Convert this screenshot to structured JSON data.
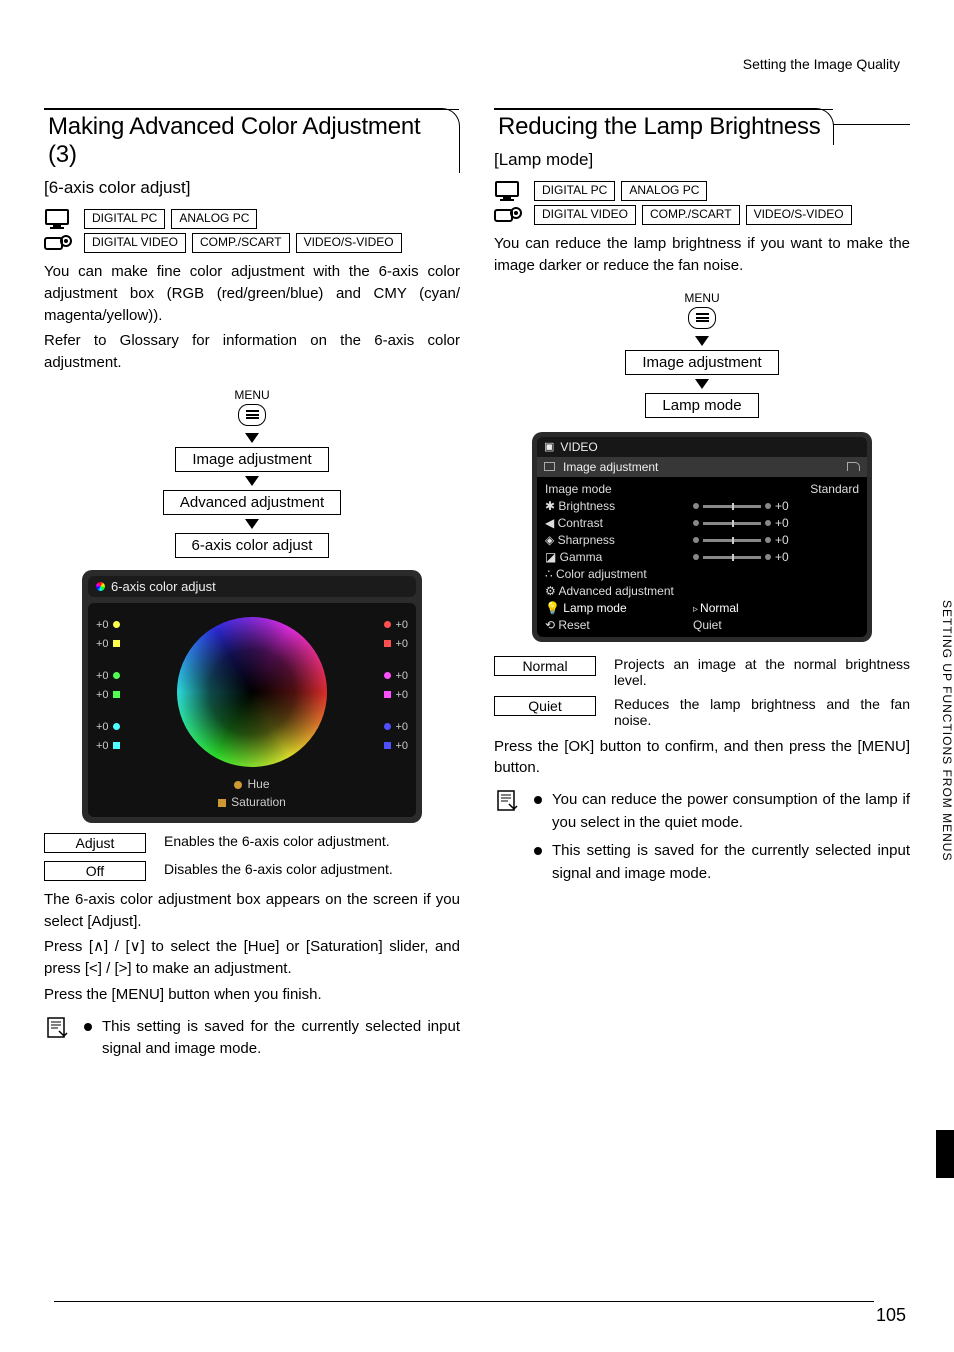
{
  "header_text": "Setting the Image Quality",
  "page_number": "105",
  "side_tab": "SETTING UP FUNCTIONS FROM MENUS",
  "left": {
    "title": "Making Advanced Color Adjustment (3)",
    "subtitle": "[6-axis color adjust]",
    "badges_row1": [
      "DIGITAL PC",
      "ANALOG PC"
    ],
    "badges_row2": [
      "DIGITAL VIDEO",
      "COMP./SCART",
      "VIDEO/S-VIDEO"
    ],
    "para1": "You can make fine color adjustment with the 6-axis color adjustment box (RGB (red/green/blue) and CMY (cyan/ magenta/yellow)).",
    "para2": "Refer to Glossary for information on the 6-axis color adjustment.",
    "menu_label": "MENU",
    "menu_steps": [
      "Image adjustment",
      "Advanced adjustment",
      "6-axis color adjust"
    ],
    "adj_title": "6-axis color adjust",
    "axis_values": [
      "+0",
      "+0",
      "+0",
      "+0",
      "+0",
      "+0",
      "+0",
      "+0",
      "+0",
      "+0",
      "+0",
      "+0"
    ],
    "legend_hue": "Hue",
    "legend_sat": "Saturation",
    "options": [
      {
        "label": "Adjust",
        "desc": "Enables the 6-axis color adjustment."
      },
      {
        "label": "Off",
        "desc": "Disables the 6-axis color adjustment."
      }
    ],
    "para3": "The 6-axis color adjustment box appears on the screen if you select [Adjust].",
    "para4": "Press [∧] / [∨] to select the [Hue] or [Saturation] slider, and press [<] / [>] to make an adjustment.",
    "para5": "Press the [MENU] button when you finish.",
    "note": "This setting is saved for the currently selected input signal and image mode."
  },
  "right": {
    "title": "Reducing the Lamp Brightness",
    "subtitle": "[Lamp mode]",
    "badges_row1": [
      "DIGITAL PC",
      "ANALOG PC"
    ],
    "badges_row2": [
      "DIGITAL VIDEO",
      "COMP./SCART",
      "VIDEO/S-VIDEO"
    ],
    "para1": "You can reduce the lamp brightness if you want to make the image darker or reduce the fan noise.",
    "menu_label": "MENU",
    "menu_steps": [
      "Image adjustment",
      "Lamp mode"
    ],
    "ms_header": "VIDEO",
    "ms_sub": "Image adjustment",
    "ms_rows": [
      {
        "name": "Image mode",
        "val": "Standard",
        "type": "text"
      },
      {
        "name": "Brightness",
        "val": "+0",
        "type": "slider"
      },
      {
        "name": "Contrast",
        "val": "+0",
        "type": "slider"
      },
      {
        "name": "Sharpness",
        "val": "+0",
        "type": "slider"
      },
      {
        "name": "Gamma",
        "val": "+0",
        "type": "slider"
      },
      {
        "name": "Color adjustment",
        "val": "",
        "type": "none"
      },
      {
        "name": "Advanced adjustment",
        "val": "",
        "type": "none"
      },
      {
        "name": "Lamp mode",
        "val": "Normal",
        "type": "ptr"
      },
      {
        "name": "Reset",
        "val": "Quiet",
        "type": "sub"
      }
    ],
    "options": [
      {
        "label": "Normal",
        "desc": "Projects an image at the normal brightness level."
      },
      {
        "label": "Quiet",
        "desc": "Reduces the lamp brightness and the fan noise."
      }
    ],
    "para2": "Press the [OK] button to confirm, and then press the [MENU] button.",
    "notes": [
      "You can reduce the power consumption of the lamp if you select in the quiet mode.",
      "This setting is saved for the currently selected input signal and image mode."
    ]
  }
}
